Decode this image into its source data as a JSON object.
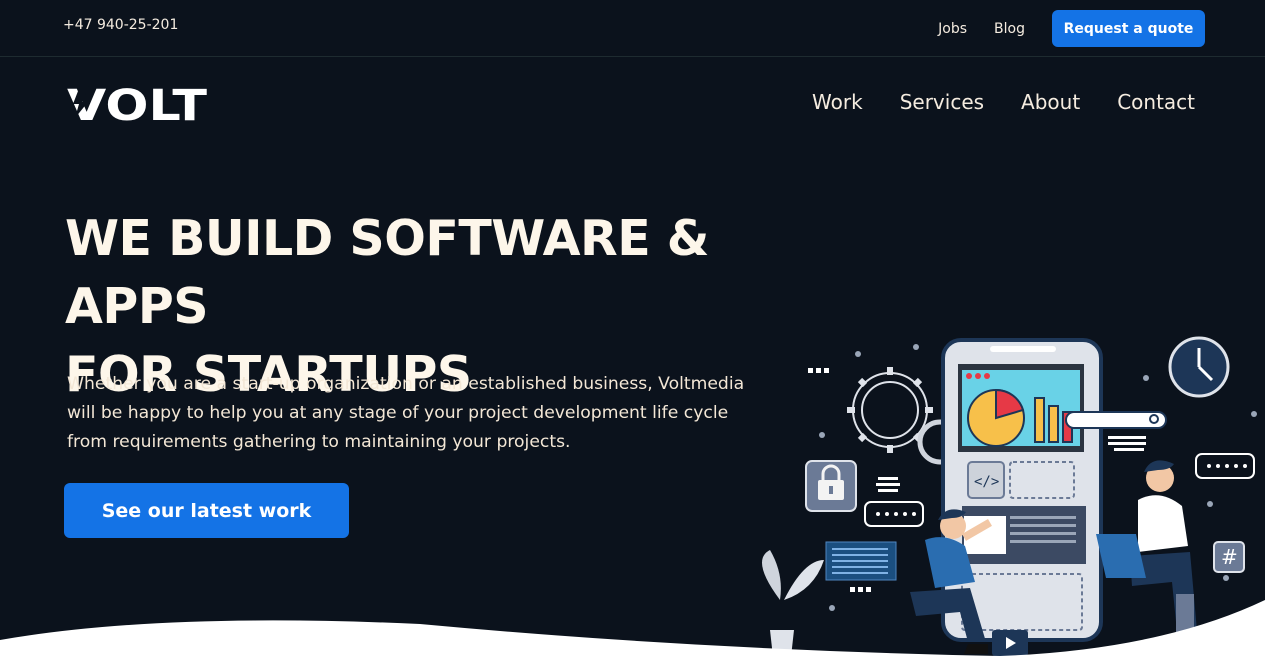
{
  "topbar": {
    "phone": "+47 940-25-201",
    "links": [
      "Jobs",
      "Blog"
    ],
    "quote_button": "Request a quote"
  },
  "brand": {
    "logo_text": "VOLT"
  },
  "nav": {
    "items": [
      "Work",
      "Services",
      "About",
      "Contact"
    ]
  },
  "hero": {
    "title_line1": "WE BUILD SOFTWARE & APPS",
    "title_line2": "FOR STARTUPS",
    "text": "Whether you are a start-up organization or an established business, Voltmedia will be happy to help you at any stage of your project development life cycle from requirements gathering to maintaining your projects.",
    "cta": "See our latest work"
  },
  "illustration": {
    "hash_symbol": "#"
  },
  "colors": {
    "background": "#0b121c",
    "accent": "#1473e6",
    "text": "#fbf3e6"
  }
}
